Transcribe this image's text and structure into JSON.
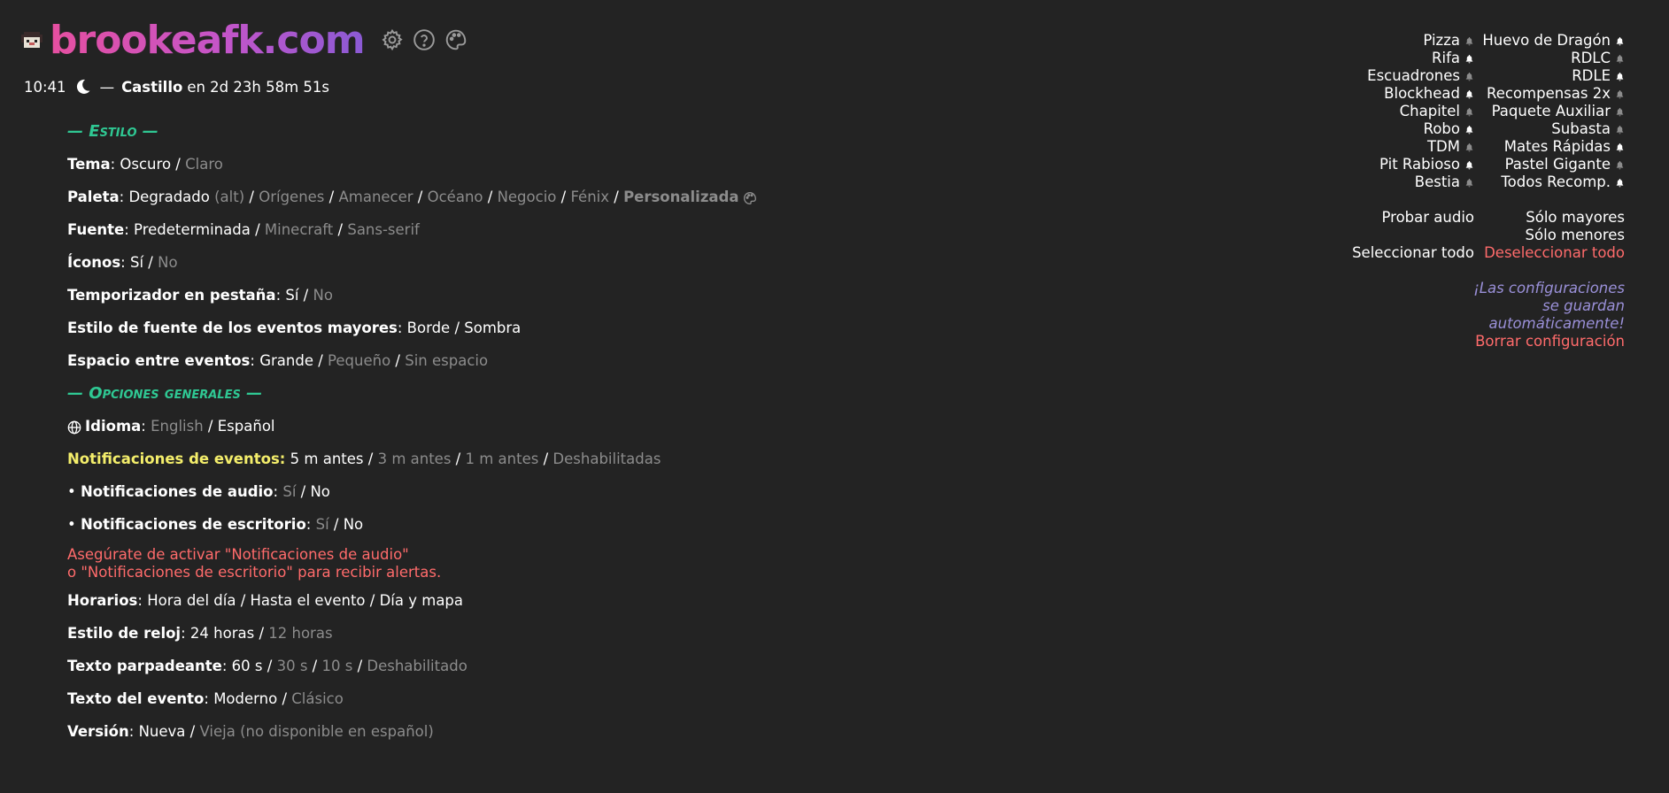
{
  "header": {
    "title": "brookeafk.com",
    "icons": [
      "settings-gear-icon",
      "help-question-icon",
      "palette-icon"
    ],
    "gradient": [
      "#e64fa0",
      "#8b5ad4"
    ]
  },
  "clock": {
    "time": "10:41",
    "dash": "—",
    "event_name": "Castillo",
    "countdown": "en 2d 23h 58m 51s"
  },
  "sections": {
    "style": "— Estilo —",
    "general": "— Opciones generales —"
  },
  "style": {
    "tema": {
      "label": "Tema",
      "options": [
        "Oscuro",
        "Claro"
      ]
    },
    "paleta": {
      "label": "Paleta",
      "opt1": "Degradado",
      "opt1_note": "(alt)",
      "options": [
        "Orígenes",
        "Amanecer",
        "Océano",
        "Negocio",
        "Fénix"
      ],
      "custom": "Personalizada"
    },
    "fuente": {
      "label": "Fuente",
      "options": [
        "Predeterminada",
        "Minecraft",
        "Sans-serif"
      ]
    },
    "iconos": {
      "label": "Íconos",
      "options": [
        "Sí",
        "No"
      ]
    },
    "temporizador": {
      "label": "Temporizador en pestaña",
      "options": [
        "Sí",
        "No"
      ]
    },
    "estilo_fuente": {
      "label": "Estilo de fuente de los eventos mayores",
      "options": [
        "Borde",
        "Sombra"
      ]
    },
    "espacio": {
      "label": "Espacio entre eventos",
      "options": [
        "Grande",
        "Pequeño",
        "Sin espacio"
      ]
    }
  },
  "general": {
    "idioma": {
      "label": "Idioma",
      "options": [
        "English",
        "Español"
      ]
    },
    "notif": {
      "label": "Notificaciones de eventos",
      "options": [
        "5 m antes",
        "3 m antes",
        "1 m antes",
        "Deshabilitadas"
      ]
    },
    "audio": {
      "bullet": "•",
      "label": "Notificaciones de audio",
      "options": [
        "Sí",
        "No"
      ]
    },
    "escritorio": {
      "bullet": "•",
      "label": "Notificaciones de escritorio",
      "options": [
        "Sí",
        "No"
      ]
    },
    "warning_line1": "Asegúrate de activar \"Notificaciones de audio\"",
    "warning_line2": "o \"Notificaciones de escritorio\" para recibir alertas.",
    "horarios": {
      "label": "Horarios",
      "options": [
        "Hora del día",
        "Hasta el evento",
        "Día y mapa"
      ]
    },
    "reloj": {
      "label": "Estilo de reloj",
      "options": [
        "24 horas",
        "12 horas"
      ]
    },
    "parpadeante": {
      "label": "Texto parpadeante",
      "options": [
        "60 s",
        "30 s",
        "10 s",
        "Deshabilitado"
      ]
    },
    "texto_evento": {
      "label": "Texto del evento",
      "options": [
        "Moderno",
        "Clásico"
      ]
    },
    "version": {
      "label": "Versión",
      "options": [
        "Nueva",
        "Vieja (no disponible en español)"
      ]
    }
  },
  "events": {
    "col1": [
      {
        "name": "Pizza",
        "bell": "off"
      },
      {
        "name": "Rifa",
        "bell": "on"
      },
      {
        "name": "Escuadrones",
        "bell": "off"
      },
      {
        "name": "Blockhead",
        "bell": "on"
      },
      {
        "name": "Chapitel",
        "bell": "off"
      },
      {
        "name": "Robo",
        "bell": "on"
      },
      {
        "name": "TDM",
        "bell": "off"
      },
      {
        "name": "Pit Rabioso",
        "bell": "on"
      },
      {
        "name": "Bestia",
        "bell": "off"
      }
    ],
    "col2": [
      {
        "name": "Huevo de Dragón",
        "bell": "on"
      },
      {
        "name": "RDLC",
        "bell": "off"
      },
      {
        "name": "RDLE",
        "bell": "on"
      },
      {
        "name": "Recompensas 2x",
        "bell": "off"
      },
      {
        "name": "Paquete Auxiliar",
        "bell": "off"
      },
      {
        "name": "Subasta",
        "bell": "off"
      },
      {
        "name": "Mates Rápidas",
        "bell": "on"
      },
      {
        "name": "Pastel Gigante",
        "bell": "off"
      },
      {
        "name": "Todos Recomp.",
        "bell": "on"
      }
    ]
  },
  "controls": {
    "test_audio": "Probar audio",
    "major_only": "Sólo mayores",
    "minor_only": "Sólo menores",
    "select_all": "Seleccionar todo",
    "deselect_all": "Deseleccionar todo"
  },
  "saved_note": {
    "line1": "¡Las configuraciones",
    "line2": "se guardan",
    "line3": "automáticamente!",
    "reset": "Borrar configuración"
  },
  "colors": {
    "background": "#232323",
    "section": "#2fc893",
    "highlight": "#f4ee6b",
    "warning": "#ff6b6b",
    "note": "#9a90d8",
    "dim": "#8c8c8c"
  }
}
